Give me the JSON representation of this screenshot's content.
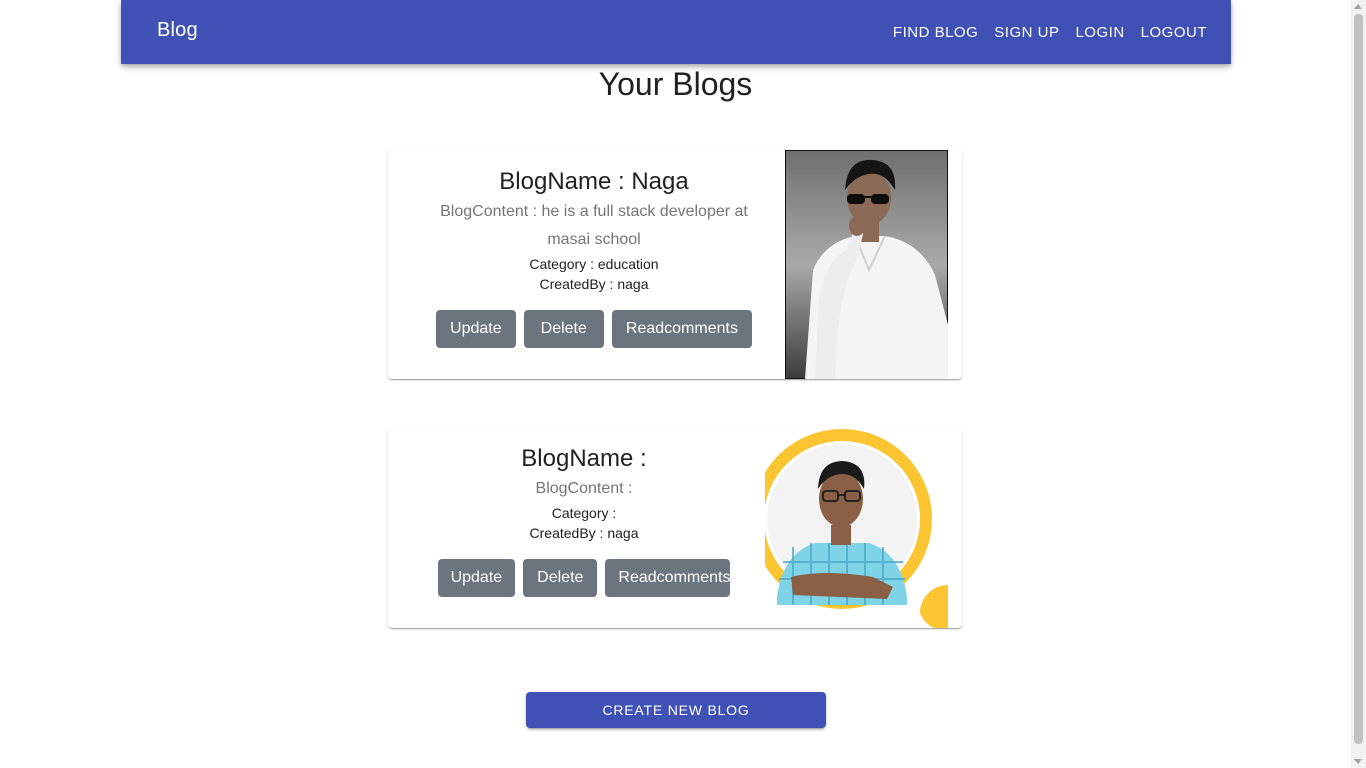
{
  "appbar": {
    "brand": "Blog",
    "nav": [
      "FIND BLOG",
      "SIGN UP",
      "LOGIN",
      "LOGOUT"
    ]
  },
  "page_title": "Your Blogs",
  "blogs": [
    {
      "name": "BlogName : Naga",
      "content_line1": "BlogContent : he is a full stack developer at",
      "content_line2": "masai school",
      "category": "Category : education",
      "created_by": "CreatedBy : naga",
      "buttons": [
        "Update",
        "Delete",
        "Readcomments"
      ]
    },
    {
      "name": "BlogName :",
      "content_line1": "BlogContent :",
      "content_line2": "",
      "category": "Category :",
      "created_by": "CreatedBy : naga",
      "buttons": [
        "Update",
        "Delete",
        "Readcomments"
      ]
    }
  ],
  "create_button": "CREATE NEW BLOG",
  "colors": {
    "primary": "#3f51b5",
    "button_gray": "#6c757d",
    "accent_yellow": "#fbc531"
  }
}
